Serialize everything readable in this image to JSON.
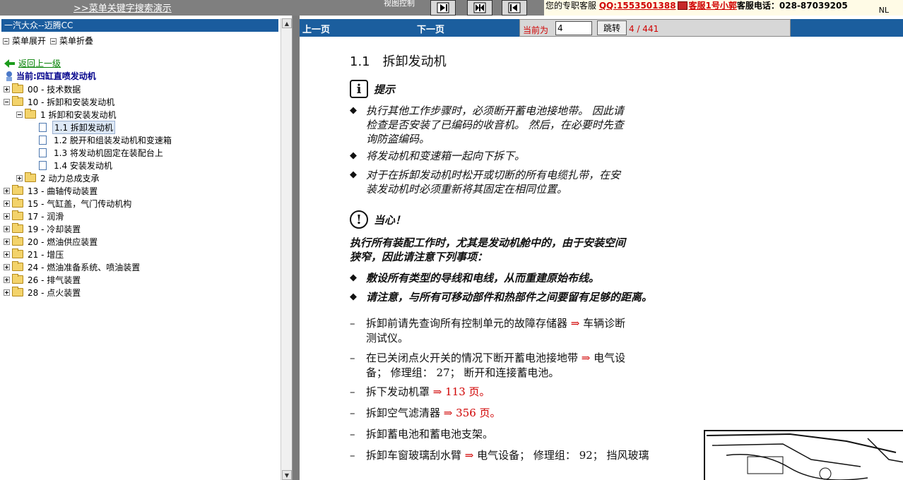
{
  "topbar": {
    "search_link": ">>菜单关键字搜索演示",
    "view_control": "视图控制",
    "service": {
      "prefix": "您的专职客服",
      "qq": "QQ:1553501388",
      "agent": "客服1号小郭",
      "phone": "客服电话：028-87039205",
      "corner": "NL"
    }
  },
  "left": {
    "title": "一汽大众--迈腾CC",
    "expand_label": "菜单展开",
    "collapse_label": "菜单折叠",
    "back_label": "返回上一级",
    "current_label": "当前:四缸直喷发动机",
    "tree": [
      {
        "label": "00 - 技术数据"
      },
      {
        "label": "10 - 拆卸和安装发动机"
      },
      {
        "label": "1 拆卸和安装发动机"
      },
      {
        "label": "1.1 拆卸发动机"
      },
      {
        "label": "1.2 脱开和组装发动机和变速箱"
      },
      {
        "label": "1.3 将发动机固定在装配台上"
      },
      {
        "label": "1.4 安装发动机"
      },
      {
        "label": "2 动力总成支承"
      },
      {
        "label": "13 - 曲轴传动装置"
      },
      {
        "label": "15 - 气缸盖，气门传动机构"
      },
      {
        "label": "17 - 润滑"
      },
      {
        "label": "19 - 冷却装置"
      },
      {
        "label": "20 - 燃油供应装置"
      },
      {
        "label": "21 - 增压"
      },
      {
        "label": "24 - 燃油准备系统、喷油装置"
      },
      {
        "label": "26 - 排气装置"
      },
      {
        "label": "28 - 点火装置"
      }
    ]
  },
  "nav": {
    "prev": "上一页",
    "next": "下一页",
    "current_label": "当前为",
    "page_value": "4",
    "jump": "跳转",
    "page_count": "4 / 441"
  },
  "doc": {
    "title": "1.1　拆卸发动机",
    "note_title": "提示",
    "note_icon": "i",
    "notes": [
      "执行其他工作步骤时，必须断开蓄电池接地带。 因此请检查是否安装了已编码的收音机。 然后，在必要时先查询防盗编码。",
      "将发动机和变速箱一起向下拆下。",
      "对于在拆卸发动机时松开或切断的所有电缆扎带，在安装发动机时必须重新将其固定在相同位置。"
    ],
    "caution_title": "当心！",
    "caution_icon": "!",
    "caution_text": "执行所有装配工作时，尤其是发动机舱中的，由于安装空间狭窄，因此请注意下列事项：",
    "cautions": [
      "敷设所有类型的导线和电线，从而重建原始布线。",
      "请注意，与所有可移动部件和热部件之间要留有足够的距离。"
    ],
    "bullet_marker": "◆",
    "step_marker": "–",
    "arrow": "⇒",
    "steps": [
      {
        "text": "拆卸前请先查询所有控制单元的故障存储器",
        "ref": "车辆诊断测试仪。"
      },
      {
        "text": "在已关闭点火开关的情况下断开蓄电池接地带",
        "ref": "电气设备； 修理组： 27； 断开和连接蓄电池。"
      },
      {
        "text": "拆下发动机罩",
        "ref": "113 页。"
      },
      {
        "text": "拆卸空气滤清器",
        "ref": "356 页。"
      },
      {
        "text": "拆卸蓄电池和蓄电池支架。",
        "ref": ""
      },
      {
        "text": "拆卸车窗玻璃刮水臂",
        "ref": "电气设备； 修理组： 92； 挡风玻璃"
      }
    ]
  },
  "colors": {
    "title_bar": "#1a5c9e",
    "nav_bar": "#1b5e9e",
    "accent_red": "#d00000",
    "link_green": "#008000"
  }
}
